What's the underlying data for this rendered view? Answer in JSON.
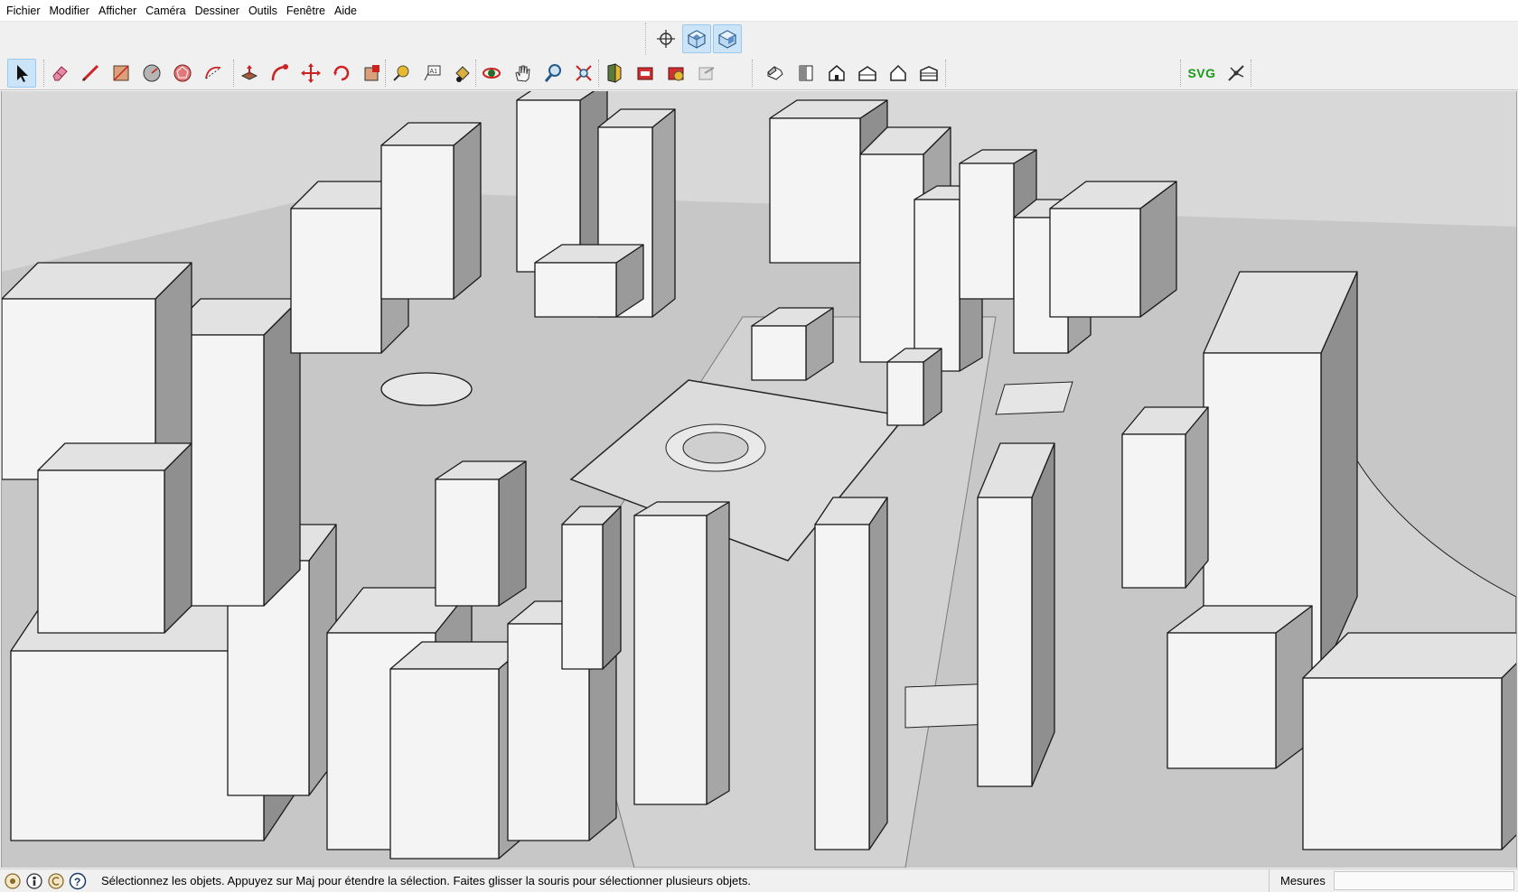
{
  "app": {
    "accent": "#0078d7"
  },
  "menu": [
    {
      "label": "Fichier"
    },
    {
      "label": "Modifier"
    },
    {
      "label": "Afficher"
    },
    {
      "label": "Caméra"
    },
    {
      "label": "Dessiner"
    },
    {
      "label": "Outils"
    },
    {
      "label": "Fenêtre"
    },
    {
      "label": "Aide"
    }
  ],
  "views_toolbar": {
    "items": [
      "position-camera-icon",
      "iso-view-icon",
      "top-view-icon"
    ]
  },
  "main_toolbar": {
    "groups": [
      [
        "select-arrow-icon"
      ],
      [
        "eraser-icon",
        "pencil-line-icon",
        "rectangle-icon",
        "circle-icon",
        "polygon-icon",
        "arc-icon"
      ],
      [
        "push-pull-icon",
        "follow-me-icon",
        "move-icon",
        "rotate-icon",
        "scale-icon"
      ],
      [
        "tape-measure-icon",
        "text-icon",
        "paint-bucket-icon"
      ],
      [
        "orbit-icon",
        "pan-hand-icon",
        "zoom-icon",
        "zoom-extents-icon"
      ],
      [
        "section-plane-icon",
        "warehouse-icon",
        "extension-warehouse-icon",
        "share-model-icon"
      ],
      [
        "house-iso-icon",
        "house-front-icon",
        "house-top-icon",
        "house-right-icon",
        "house-back-icon",
        "house-left-icon"
      ]
    ],
    "extension": {
      "svg_label": "SVG",
      "plugin_icon": "plugin-insect-icon"
    }
  },
  "viewport": {
    "description_icon": "3d-city-model",
    "sky_color": "#d6d6d6",
    "ground_color": "#c9c9c9"
  },
  "status": {
    "icons": [
      "geolocation-icon",
      "credits-icon",
      "copyright-icon",
      "help-icon"
    ],
    "message": "Sélectionnez les objets. Appuyez sur Maj pour étendre la sélection. Faites glisser la souris pour sélectionner plusieurs objets.",
    "measure_label": "Mesures",
    "measure_value": ""
  }
}
